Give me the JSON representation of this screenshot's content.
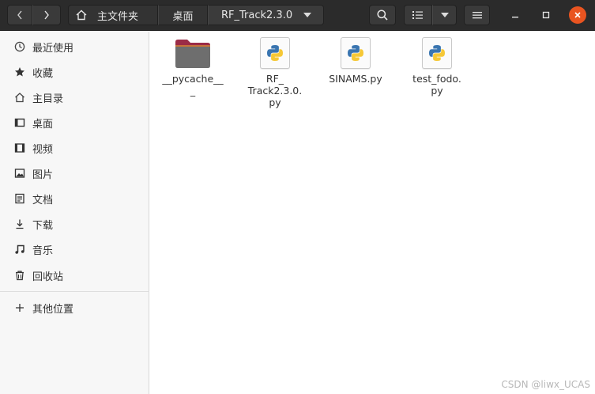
{
  "header": {
    "breadcrumb": [
      {
        "label": "主文件夹",
        "icon": "home-icon"
      },
      {
        "label": "桌面"
      },
      {
        "label": "RF_Track2.3.0",
        "current": true
      }
    ],
    "accent_close": "#e95420"
  },
  "sidebar": {
    "items": [
      {
        "label": "最近使用",
        "icon": "clock-icon"
      },
      {
        "label": "收藏",
        "icon": "star-icon"
      },
      {
        "label": "主目录",
        "icon": "home-icon"
      },
      {
        "label": "桌面",
        "icon": "desktop-icon"
      },
      {
        "label": "视频",
        "icon": "film-icon"
      },
      {
        "label": "图片",
        "icon": "image-icon"
      },
      {
        "label": "文档",
        "icon": "document-icon"
      },
      {
        "label": "下载",
        "icon": "download-icon"
      },
      {
        "label": "音乐",
        "icon": "music-icon"
      },
      {
        "label": "回收站",
        "icon": "trash-icon"
      },
      {
        "label": "其他位置",
        "icon": "plus-icon"
      }
    ]
  },
  "files": [
    {
      "name": "__pycache__\n_",
      "type": "folder",
      "icon": "folder-icon"
    },
    {
      "name": "RF_\nTrack2.3.0.\npy",
      "type": "python",
      "icon": "python-file-icon"
    },
    {
      "name": "SINAMS.py",
      "type": "python",
      "icon": "python-file-icon"
    },
    {
      "name": "test_fodo.\npy",
      "type": "python",
      "icon": "python-file-icon"
    }
  ],
  "watermark": "CSDN @liwx_UCAS"
}
